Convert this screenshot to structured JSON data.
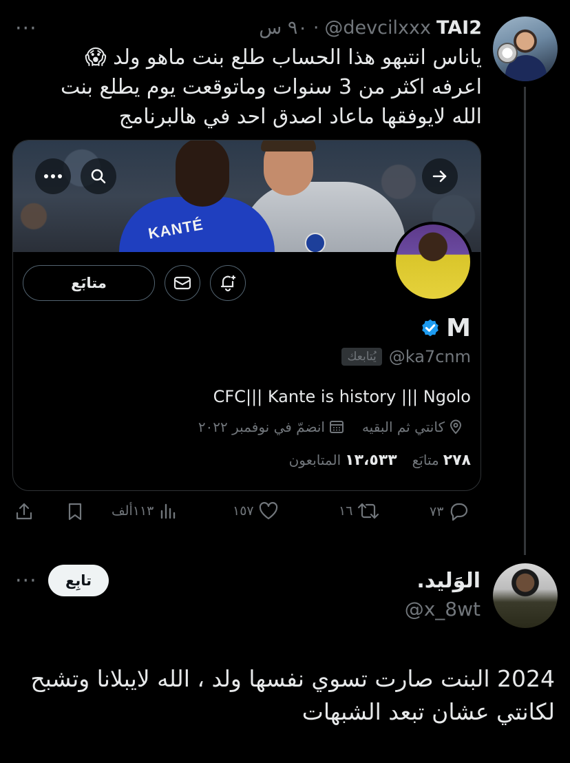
{
  "tweet1": {
    "display_name": "TAI2",
    "handle": "@devcilxxx",
    "time": "٩٠ س",
    "separator": "·",
    "more": "···",
    "text_lines": [
      "ياناس انتبهو هذا الحساب طلع بنت ماهو ولد 😱",
      "اعرفه اكثر من 3 سنوات وماتوقعت يوم يطلع بنت",
      "الله لايوفقها ماعاد اصدق احد في هالبرنامج"
    ],
    "actions": {
      "replies": "٧٣",
      "reposts": "١٦",
      "likes": "١٥٧",
      "views": "١١٣ألف"
    }
  },
  "profile_card": {
    "name": "M",
    "handle": "@ka7cnm",
    "follows_you": "يُتابعك",
    "bio": "CFC||| Kante is history ||| Ngolo",
    "location": "كانتي ثم البقيه",
    "joined": "انضمّ في نوفمبر ٢٠٢٢",
    "following_count": "٢٧٨",
    "following_label": "متابَع",
    "followers_count": "١٣،٥٣٣",
    "followers_label": "المتابعون",
    "follow_button": "متابَع",
    "banner_text": "KANTÉ"
  },
  "tweet2": {
    "display_name": "الوَليد.",
    "handle": "@x_8wt",
    "follow_button": "تابِع",
    "more": "···",
    "text_lines": [
      "2024 البنت صارت تسوي نفسها ولد ، الله لايبلانا وتشبح",
      "لكانتي عشان تبعد الشبهات"
    ]
  },
  "colors": {
    "background": "#000000",
    "text": "#e7e9ea",
    "muted": "#71767b",
    "verified": "#1d9bf0",
    "border": "#2f3336"
  }
}
